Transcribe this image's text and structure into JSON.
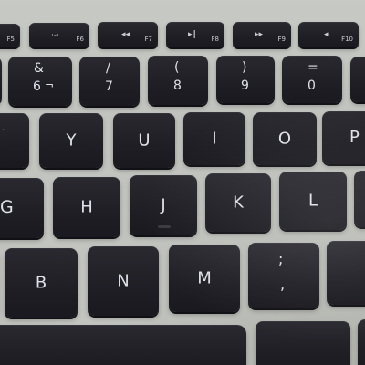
{
  "keyboard": {
    "function_row": [
      {
        "label": "F5",
        "icon_name": "keyboard-light-icon",
        "icon": ""
      },
      {
        "label": "F6",
        "icon_name": "keyboard-light-up-icon",
        "icon": "·-·"
      },
      {
        "label": "F7",
        "icon_name": "rewind-icon",
        "icon": "◂◂"
      },
      {
        "label": "F8",
        "icon_name": "play-pause-icon",
        "icon": "▸‖"
      },
      {
        "label": "F9",
        "icon_name": "fast-forward-icon",
        "icon": "▸▸"
      },
      {
        "label": "F10",
        "icon_name": "mute-icon",
        "icon": "◂"
      }
    ],
    "number_row": [
      {
        "top": "&",
        "bottom": "6",
        "extra": "¬"
      },
      {
        "top": "/",
        "bottom": "7"
      },
      {
        "top": "(",
        "bottom": "8"
      },
      {
        "top": ")",
        "bottom": "9"
      },
      {
        "top": "=",
        "bottom": "0"
      }
    ],
    "top_letter_row": [
      "Y",
      "U",
      "I",
      "O",
      "P"
    ],
    "home_row": [
      "G",
      "H",
      "J",
      "K",
      "L"
    ],
    "bottom_row": [
      "B",
      "N",
      "M"
    ],
    "punctuation_key": {
      "top": ";",
      "bottom": ","
    }
  }
}
